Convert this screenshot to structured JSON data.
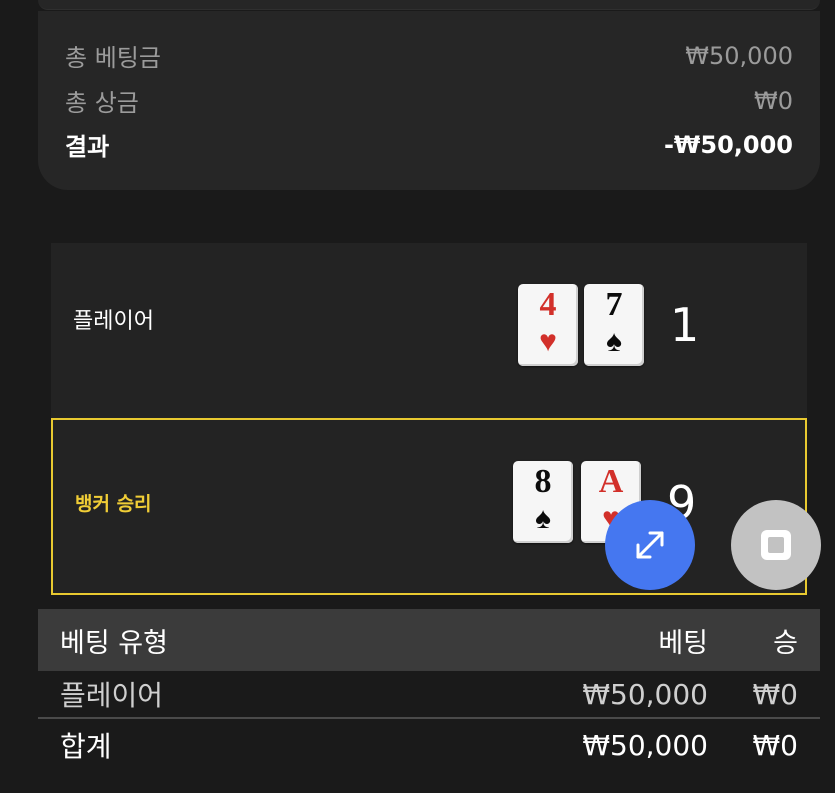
{
  "summary": {
    "total_bet_label": "총 베팅금",
    "total_bet_value": "₩50,000",
    "total_prize_label": "총 상금",
    "total_prize_value": "₩0",
    "result_label": "결과",
    "result_value": "-₩50,000"
  },
  "hands": {
    "player": {
      "label": "플레이어",
      "cards": [
        {
          "rank": "4",
          "suit": "♥",
          "color": "red"
        },
        {
          "rank": "7",
          "suit": "♠",
          "color": "black"
        }
      ],
      "score": "1"
    },
    "banker": {
      "label": "뱅커 승리",
      "cards": [
        {
          "rank": "8",
          "suit": "♠",
          "color": "black"
        },
        {
          "rank": "A",
          "suit": "♥",
          "color": "red"
        }
      ],
      "score": "9"
    }
  },
  "controls": {
    "expand_icon": "expand-arrows-icon",
    "stop_icon": "stop-square-icon",
    "expand_color": "#4577f0",
    "stop_color": "#c2c2c2"
  },
  "bet_table": {
    "headers": {
      "type": "베팅 유형",
      "bet": "베팅",
      "win": "승"
    },
    "rows": [
      {
        "type": "플레이어",
        "bet": "₩50,000",
        "win": "₩0"
      }
    ],
    "total": {
      "type": "합계",
      "bet": "₩50,000",
      "win": "₩0"
    }
  },
  "colors": {
    "background": "#1a1a1a",
    "panel": "#262626",
    "winner_highlight": "#e8c930",
    "winner_text": "#f0cd36",
    "card_red": "#d2302a"
  }
}
